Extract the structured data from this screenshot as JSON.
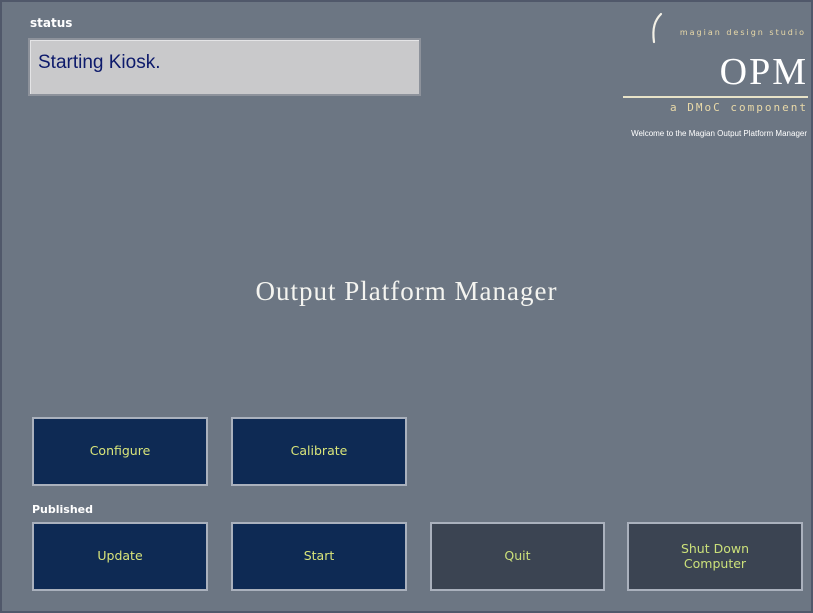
{
  "status": {
    "label": "status",
    "message": "Starting Kiosk."
  },
  "brand": {
    "studio": "magian design studio",
    "product": "OPM",
    "tagline": "a DMoC component",
    "welcome": "Welcome to the Magian Output Platform Manager"
  },
  "main": {
    "title": "Output Platform Manager"
  },
  "buttons": {
    "configure": "Configure",
    "calibrate": "Calibrate",
    "published_label": "Published",
    "update": "Update",
    "start": "Start",
    "quit": "Quit",
    "shutdown": "Shut Down Computer"
  },
  "colors": {
    "background": "#6c7683",
    "primary_button": "#0e2a54",
    "secondary_button": "#3b4452",
    "button_text": "#d9e57a",
    "status_text": "#0d1a6b"
  }
}
